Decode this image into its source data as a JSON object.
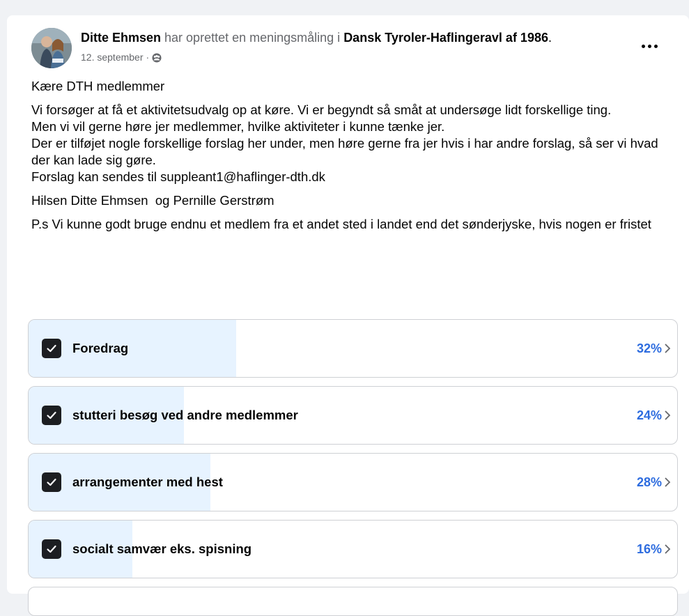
{
  "post": {
    "author": "Ditte Ehmsen",
    "action_text": " har oprettet en meningsmåling i ",
    "group": "Dansk Tyroler-Haflingeravl af 1986",
    "group_suffix": ".",
    "date": "12. september",
    "separator": "·",
    "privacy_icon": "group-members-icon",
    "more_icon": "more-dots-icon",
    "paragraphs": [
      "Kære DTH medlemmer",
      "Vi forsøger at få et aktivitetsudvalg op at køre. Vi er begyndt så småt at undersøge lidt forskellige ting.\nMen vi vil gerne høre jer medlemmer, hvilke aktiviteter i kunne tænke jer.\nDer er tilføjet nogle forskellige forslag her under, men høre gerne fra jer hvis i har andre forslag, så ser vi hvad der kan lade sig gøre.\nForslag kan sendes til suppleant1@haflinger-dth.dk",
      "Hilsen Ditte Ehmsen  og Pernille Gerstrøm",
      "P.s Vi kunne godt bruge endnu et medlem fra et andet sted i landet end det sønderjyske, hvis nogen er fristet"
    ]
  },
  "poll": {
    "fill_color": "#e7f3ff",
    "percent_color": "#2d6cdf",
    "options": [
      {
        "label": "Foredrag",
        "percent": "32%",
        "share": 0.32,
        "checked": true
      },
      {
        "label": "stutteri besøg ved andre medlemmer",
        "percent": "24%",
        "share": 0.24,
        "checked": true
      },
      {
        "label": "arrangementer med hest",
        "percent": "28%",
        "share": 0.28,
        "checked": true
      },
      {
        "label": "socialt samvær eks. spisning",
        "percent": "16%",
        "share": 0.16,
        "checked": true
      }
    ]
  }
}
